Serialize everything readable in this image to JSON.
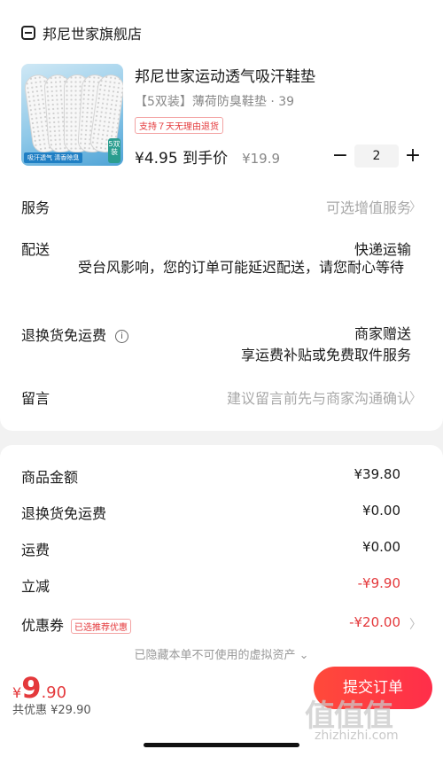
{
  "shop": {
    "name": "邦尼世家旗舰店",
    "icon": "store-icon"
  },
  "product": {
    "title": "邦尼世家运动透气吸汗鞋垫",
    "spec": "【5双装】薄荷防臭鞋垫 · 39",
    "refund_tag": "支持７天无理由退货",
    "final_price": "¥4.95 到手价",
    "orig_price": "¥19.9",
    "quantity": "2",
    "img_caption": "吸汗透气 清香除臭",
    "img_badge": "5双装"
  },
  "rows": {
    "service": {
      "label": "服务",
      "value": "可选增值服务"
    },
    "delivery": {
      "label": "配送",
      "value": "快递运输",
      "notice": "受台风影响，您的订单可能延迟配送，请您耐心等待"
    },
    "return_fee": {
      "label": "退换货免运费",
      "value": "商家赠送",
      "value2": "享运费补贴或免费取件服务"
    },
    "message": {
      "label": "留言",
      "placeholder": "建议留言前先与商家沟通确认"
    }
  },
  "summary": {
    "goods": {
      "label": "商品金额",
      "value": "¥39.80"
    },
    "return_fee": {
      "label": "退换货免运费",
      "value": "¥0.00"
    },
    "shipping": {
      "label": "运费",
      "value": "¥0.00"
    },
    "discount": {
      "label": "立减",
      "value": "-¥9.90"
    },
    "coupon": {
      "label": "优惠券",
      "tag": "已选推荐优惠",
      "value": "-¥20.00"
    },
    "hidden_note": "已隐藏本单不可使用的虚拟资产 ⌄"
  },
  "footer": {
    "currency": "¥",
    "total_int": "9",
    "total_dec": ".90",
    "saved": "共优惠 ¥29.90",
    "submit": "提交订单",
    "watermark": "值值值",
    "watermark_url": "zhizhizhi.com"
  },
  "colors": {
    "accent": "#e4393c",
    "button": "#ff3a42"
  }
}
